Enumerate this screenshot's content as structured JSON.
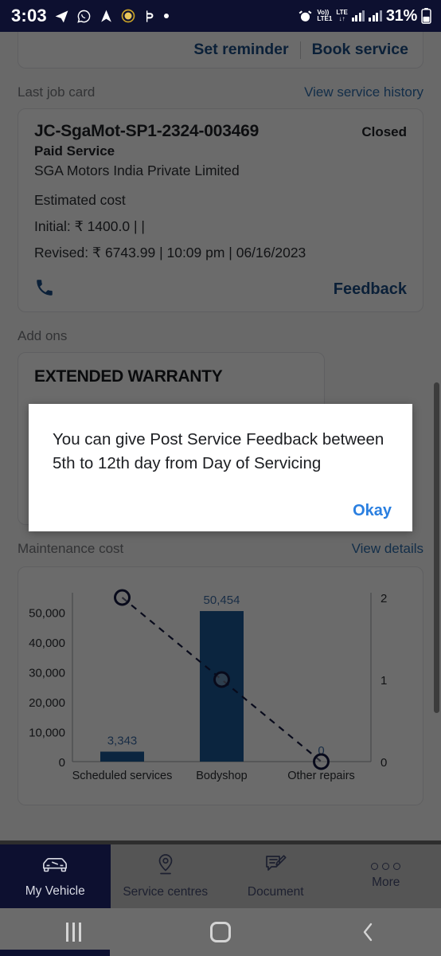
{
  "status_bar": {
    "time": "3:03",
    "left_icons": [
      "telegram-icon",
      "whatsapp-icon",
      "navigation-icon",
      "coin-icon",
      "app-icon",
      "dot-icon"
    ],
    "alarm_icon": "alarm-icon",
    "volte_line1": "Vo))",
    "volte_line2": "LTE1",
    "lte_line1": "LTE",
    "lte_line2": "↓↑",
    "battery_percent": "31%"
  },
  "top_card": {
    "set_reminder": "Set reminder",
    "book_service": "Book service"
  },
  "last_job_card": {
    "section_label": "Last job card",
    "view_history_link": "View service history",
    "job_id": "JC-SgaMot-SP1-2324-003469",
    "status": "Closed",
    "service_type": "Paid Service",
    "dealer": "SGA Motors India Private Limited",
    "estimated_cost_label": "Estimated cost",
    "initial_line": "Initial: ₹ 1400.0 |  |",
    "revised_line": "Revised: ₹ 6743.99 | 10:09 pm | 06/16/2023",
    "call_icon": "phone-icon",
    "feedback_link": "Feedback"
  },
  "add_ons": {
    "section_label": "Add ons",
    "card_title": "EXTENDED WARRANTY"
  },
  "maintenance": {
    "section_label": "Maintenance cost",
    "view_details_link": "View details"
  },
  "dialog": {
    "message": "You can give Post Service Feedback between 5th to 12th day from Day of Servicing",
    "ok_label": "Okay"
  },
  "bottom_nav": {
    "items": [
      {
        "label": "My Vehicle",
        "icon": "car-icon",
        "active": true
      },
      {
        "label": "Service centres",
        "icon": "location-pin-icon",
        "active": false
      },
      {
        "label": "Document",
        "icon": "document-edit-icon",
        "active": false
      },
      {
        "label": "More",
        "icon": "three-dots-icon",
        "active": false
      }
    ]
  },
  "system_nav": {
    "recents": "recents-icon",
    "home": "home-icon",
    "back": "back-icon"
  },
  "colors": {
    "accent_blue": "#1b4d86",
    "link_blue": "#2f6fae",
    "dialog_blue": "#2a7fe0",
    "bar_blue": "#1c5a96",
    "nav_navy": "#0d1030"
  },
  "chart_data": {
    "type": "bar",
    "title": "Maintenance cost",
    "categories": [
      "Scheduled services",
      "Bodyshop",
      "Other repairs"
    ],
    "series": [
      {
        "name": "Cost",
        "values": [
          3343,
          50454,
          0
        ],
        "labels": [
          "3,343",
          "50,454",
          "0"
        ],
        "axis": "left"
      },
      {
        "name": "Count",
        "values": [
          2,
          1,
          0
        ],
        "axis": "right",
        "style": "dashed-line-markers"
      }
    ],
    "ylabel": "",
    "ylim": [
      0,
      55000
    ],
    "yticks": [
      "0",
      "10,000",
      "20,000",
      "30,000",
      "40,000",
      "50,000"
    ],
    "ytick_values": [
      0,
      10000,
      20000,
      30000,
      40000,
      50000
    ],
    "y2lim": [
      0,
      2
    ],
    "y2ticks": [
      "0",
      "1",
      "2"
    ],
    "y2tick_values": [
      0,
      1,
      2
    ],
    "grid": false,
    "legend": "none"
  }
}
